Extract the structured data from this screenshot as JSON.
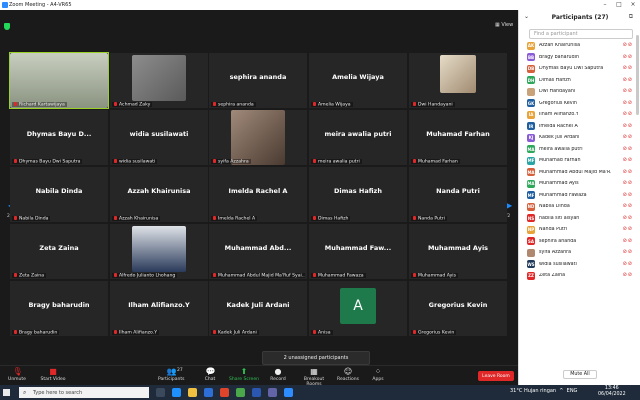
{
  "window": {
    "title": "Zoom Meeting - A4-VR65",
    "view_label": "View"
  },
  "tiles": [
    {
      "big": "",
      "label": "Richard Kartawijaya",
      "video": true,
      "active": true
    },
    {
      "big": "",
      "label": "Achmad Zaky",
      "video": true
    },
    {
      "big": "sephira ananda",
      "label": "sephira ananda"
    },
    {
      "big": "Amelia Wijaya",
      "label": "Amelia Wijaya"
    },
    {
      "big": "",
      "label": "Dwi Handayani",
      "video": true
    },
    {
      "big": "Dhymas Bayu D...",
      "label": "Dhymas Bayu Dwi Saputra"
    },
    {
      "big": "widia susilawati",
      "label": "widia susilawati"
    },
    {
      "big": "",
      "label": "syifa Azzahra",
      "video": true
    },
    {
      "big": "meira awalia putri",
      "label": "meira awalia putri"
    },
    {
      "big": "Muhamad Farhan",
      "label": "Muhamad Farhan"
    },
    {
      "big": "Nabila Dinda",
      "label": "Nabila Dinda"
    },
    {
      "big": "Azzah Khairunisa",
      "label": "Azzah Khairunisa"
    },
    {
      "big": "Imelda Rachel A",
      "label": "Imelda Rachel A"
    },
    {
      "big": "Dimas Hafizh",
      "label": "Dimas Hafizh"
    },
    {
      "big": "Nanda Putri",
      "label": "Nanda Putri"
    },
    {
      "big": "Zeta Zaina",
      "label": "Zeta Zaina"
    },
    {
      "big": "",
      "label": "Alfredo Julianto Lhohang",
      "video": true
    },
    {
      "big": "Muhammad Abd...",
      "label": "Muhammad Abdul Majid Ma'Ruf Syai..."
    },
    {
      "big": "Muhammad Faw...",
      "label": "Muhammad Fawaza"
    },
    {
      "big": "Muhammad Ayis",
      "label": "Muhammad Ayis"
    },
    {
      "big": "Bragy baharudin",
      "label": "Bragy baharudin"
    },
    {
      "big": "Ilham Alifianzo.Y",
      "label": "Ilham Alifianzo.Y"
    },
    {
      "big": "Kadek Juli Ardani",
      "label": "Kadek Juli Ardani"
    },
    {
      "big": "A",
      "label": "Anisa",
      "avatar": true
    },
    {
      "big": "Gregorius Kevin",
      "label": "Gregorius Kevin"
    }
  ],
  "paging": {
    "left": "2/2",
    "right": "2/2"
  },
  "unassigned": "2 unassigned participants",
  "toolbar": {
    "unmute": "Unmute",
    "start_video": "Start Video",
    "participants": "Participants",
    "participants_count": "27",
    "chat": "Chat",
    "share": "Share Screen",
    "record": "Record",
    "breakout": "Breakout Rooms",
    "reactions": "Reactions",
    "apps": "Apps",
    "leave": "Leave Room"
  },
  "panel": {
    "title": "Participants (27)",
    "search_placeholder": "Find a participant",
    "mute_all": "Mute All",
    "items": [
      {
        "initials": "AK",
        "name": "Azzah Khairunisa",
        "color": "#e8a33b"
      },
      {
        "initials": "BB",
        "name": "Bragy baharudin",
        "color": "#8a5bd6"
      },
      {
        "initials": "DB",
        "name": "Dhymas Bayu Dwi Saputra",
        "color": "#d6603b"
      },
      {
        "initials": "DH",
        "name": "Dimas Hafizh",
        "color": "#2ea85a"
      },
      {
        "initials": "",
        "name": "Dwi Handayani",
        "color": "#c9a27a"
      },
      {
        "initials": "GK",
        "name": "Gregorius Kevin",
        "color": "#1f5fa0"
      },
      {
        "initials": "IA",
        "name": "Ilham Alifianzo.Y",
        "color": "#e8a33b"
      },
      {
        "initials": "IR",
        "name": "Imelda Rachel A",
        "color": "#1f5fa0"
      },
      {
        "initials": "KJ",
        "name": "Kadek Juli Ardani",
        "color": "#8a5bd6"
      },
      {
        "initials": "MA",
        "name": "meira awalia putri",
        "color": "#2ea85a"
      },
      {
        "initials": "MF",
        "name": "Muhamad Farhan",
        "color": "#2aa5a5"
      },
      {
        "initials": "MA",
        "name": "Muhammad Abdul Majid Ma'R...",
        "color": "#d6603b"
      },
      {
        "initials": "MA",
        "name": "Muhammad Ayis",
        "color": "#2ea85a"
      },
      {
        "initials": "MF",
        "name": "Muhammad Fawaza",
        "color": "#1f5fa0"
      },
      {
        "initials": "ND",
        "name": "Nabila Dinda",
        "color": "#d6603b"
      },
      {
        "initials": "NS",
        "name": "nabila siti aisyah",
        "color": "#e02828"
      },
      {
        "initials": "NP",
        "name": "Nanda Putri",
        "color": "#e8a33b"
      },
      {
        "initials": "SA",
        "name": "sephira ananda",
        "color": "#e02828"
      },
      {
        "initials": "",
        "name": "syifa Azzahra",
        "color": "#b08870"
      },
      {
        "initials": "WS",
        "name": "widia susilawati",
        "color": "#1f3a5a"
      },
      {
        "initials": "ZZ",
        "name": "Zeta Zaina",
        "color": "#e02828"
      }
    ]
  },
  "taskbar": {
    "search_placeholder": "Type here to search",
    "weather": "31°C  Hujan ringan",
    "lang": "ENG",
    "time": "13:46",
    "date": "06/04/2022"
  }
}
